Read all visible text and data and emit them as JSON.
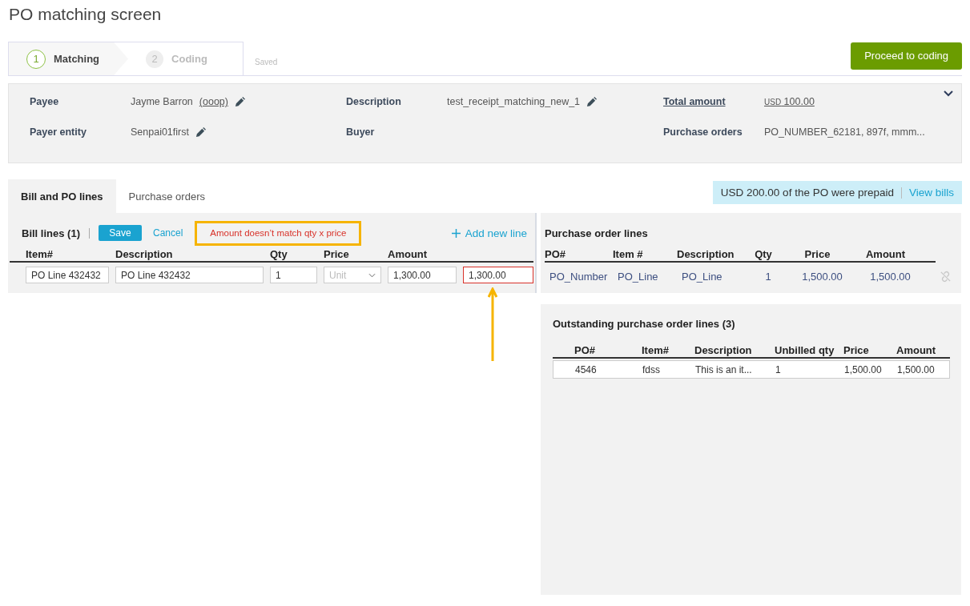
{
  "page_title": "PO matching screen",
  "steps": [
    {
      "number": "1",
      "label": "Matching",
      "selected": true
    },
    {
      "number": "2",
      "label": "Coding",
      "selected": false
    }
  ],
  "save_status": "Saved",
  "primary_button": "Proceed to coding",
  "summary": {
    "payee": {
      "label": "Payee",
      "value": "Jayme Barron",
      "link": "(ooop)"
    },
    "payer_entity": {
      "label": "Payer entity",
      "value": "Senpai01first"
    },
    "description": {
      "label": "Description",
      "value": "test_receipt_matching_new_1"
    },
    "buyer": {
      "label": "Buyer"
    },
    "total_amount": {
      "label": "Total amount",
      "currency": "USD",
      "value": "100.00"
    },
    "purchase_orders": {
      "label": "Purchase orders",
      "value": "PO_NUMBER_62181, 897f, mmm..."
    }
  },
  "tabs": [
    {
      "label": "Bill and PO lines",
      "selected": true
    },
    {
      "label": "Purchase orders",
      "selected": false
    }
  ],
  "prepaid_notice": {
    "text": "USD 200.00 of the PO were prepaid",
    "link": "View bills"
  },
  "bill_lines": {
    "title": "Bill lines (1)",
    "save": "Save",
    "cancel": "Cancel",
    "error": "Amount doesn’t match qty x price",
    "add": "Add new line",
    "columns": [
      "Item#",
      "Description",
      "Qty",
      "Price",
      "Amount"
    ],
    "rows": [
      {
        "item": "PO Line 432432",
        "description": "PO Line 432432",
        "qty": "1",
        "unit_placeholder": "Unit",
        "price": "1,300.00",
        "amount": "1,300.00",
        "amount_invalid": true
      }
    ]
  },
  "po_lines": {
    "title": "Purchase order lines",
    "columns": [
      "PO#",
      "Item #",
      "Description",
      "Qty",
      "Price",
      "Amount"
    ],
    "rows": [
      [
        "PO_Number",
        "PO_Line",
        "PO_Line",
        "1",
        "1,500.00",
        "1,500.00"
      ]
    ]
  },
  "outstanding": {
    "title": "Outstanding purchase order lines (3)",
    "columns": [
      "PO#",
      "Item#",
      "Description",
      "Unbilled qty",
      "Price",
      "Amount"
    ],
    "rows": [
      [
        "4546",
        "fdss",
        "This is an it...",
        "1",
        "1,500.00",
        "1,500.00"
      ]
    ]
  }
}
